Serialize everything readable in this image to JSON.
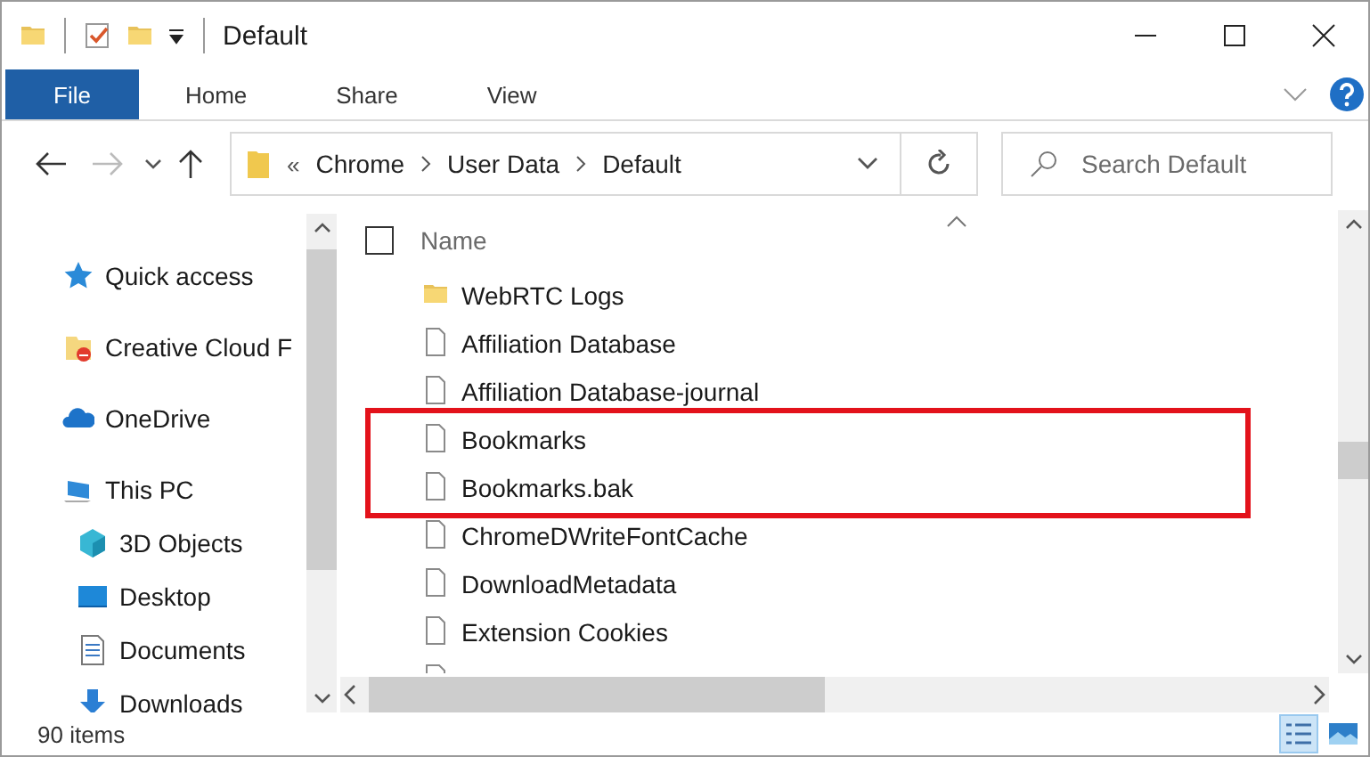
{
  "window": {
    "title": "Default"
  },
  "ribbon": {
    "tabs": [
      {
        "label": "File",
        "selected": true
      },
      {
        "label": "Home",
        "selected": false
      },
      {
        "label": "Share",
        "selected": false
      },
      {
        "label": "View",
        "selected": false
      }
    ]
  },
  "address": {
    "overflow_mark": "«",
    "crumbs": [
      "Chrome",
      "User Data",
      "Default"
    ]
  },
  "search": {
    "placeholder": "Search Default"
  },
  "nav": {
    "items": [
      {
        "label": "Quick access",
        "kind": "star"
      },
      {
        "label": "Creative Cloud F",
        "kind": "cloud-folder"
      },
      {
        "label": "OneDrive",
        "kind": "cloud"
      },
      {
        "label": "This PC",
        "kind": "pc",
        "children": [
          {
            "label": "3D Objects",
            "kind": "cube"
          },
          {
            "label": "Desktop",
            "kind": "desktop"
          },
          {
            "label": "Documents",
            "kind": "document"
          },
          {
            "label": "Downloads",
            "kind": "download"
          }
        ]
      }
    ]
  },
  "files": {
    "header": "Name",
    "select_all": {
      "checked": false
    },
    "items": [
      {
        "name": "WebRTC Logs",
        "kind": "folder",
        "highlighted": false
      },
      {
        "name": "Affiliation Database",
        "kind": "file",
        "highlighted": false
      },
      {
        "name": "Affiliation Database-journal",
        "kind": "file",
        "highlighted": false
      },
      {
        "name": "Bookmarks",
        "kind": "file",
        "highlighted": true
      },
      {
        "name": "Bookmarks.bak",
        "kind": "file",
        "highlighted": true
      },
      {
        "name": "ChromeDWriteFontCache",
        "kind": "file",
        "highlighted": false
      },
      {
        "name": "DownloadMetadata",
        "kind": "file",
        "highlighted": false
      },
      {
        "name": "Extension Cookies",
        "kind": "file",
        "highlighted": false
      }
    ]
  },
  "status_bar": {
    "count": "90 items"
  }
}
